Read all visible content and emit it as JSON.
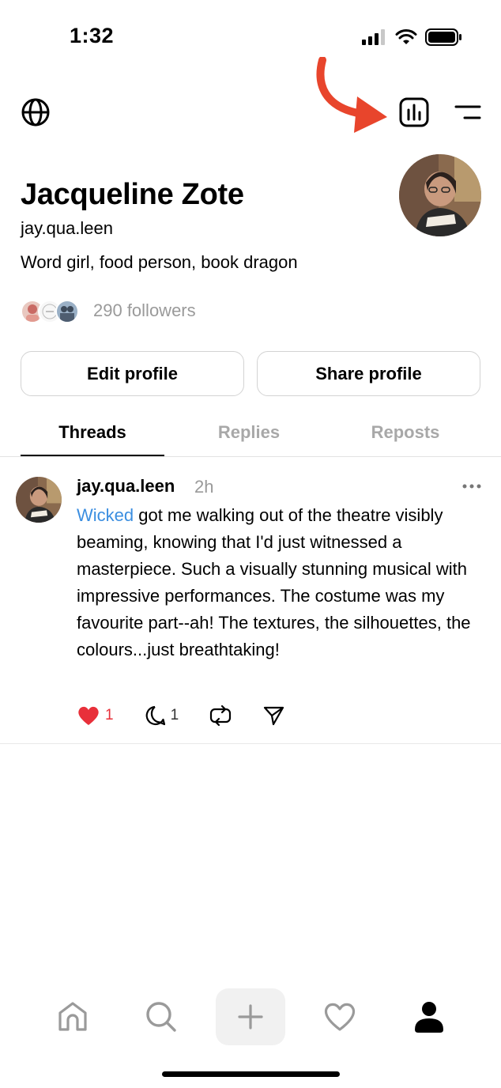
{
  "status_bar": {
    "time": "1:32"
  },
  "profile": {
    "name": "Jacqueline Zote",
    "handle": "jay.qua.leen",
    "bio": "Word girl, food person, book dragon",
    "followers_label": "290 followers",
    "edit_button": "Edit profile",
    "share_button": "Share profile"
  },
  "tabs": [
    {
      "label": "Threads",
      "active": true
    },
    {
      "label": "Replies",
      "active": false
    },
    {
      "label": "Reposts",
      "active": false
    }
  ],
  "post": {
    "author": "jay.qua.leen",
    "time": "2h",
    "link_text": "Wicked",
    "body": " got me walking out of the theatre visibly beaming, knowing that I'd just witnessed a masterpiece. Such a visually stunning musical with impressive performances. The costume was my favourite part--ah! The textures, the silhouettes, the colours...just breathtaking!",
    "likes": "1",
    "replies": "1",
    "liked": true
  },
  "icons": {
    "top_left": "globe-icon",
    "insights": "bar-chart-icon",
    "menu": "menu-icon",
    "annotation": "red-arrow-icon",
    "nav": [
      "home-icon",
      "search-icon",
      "plus-icon",
      "heart-icon",
      "profile-icon"
    ]
  },
  "colors": {
    "annotation_arrow": "#e8452c",
    "link": "#3b8ee0",
    "like": "#e8303a",
    "muted": "#9a9a9a"
  }
}
